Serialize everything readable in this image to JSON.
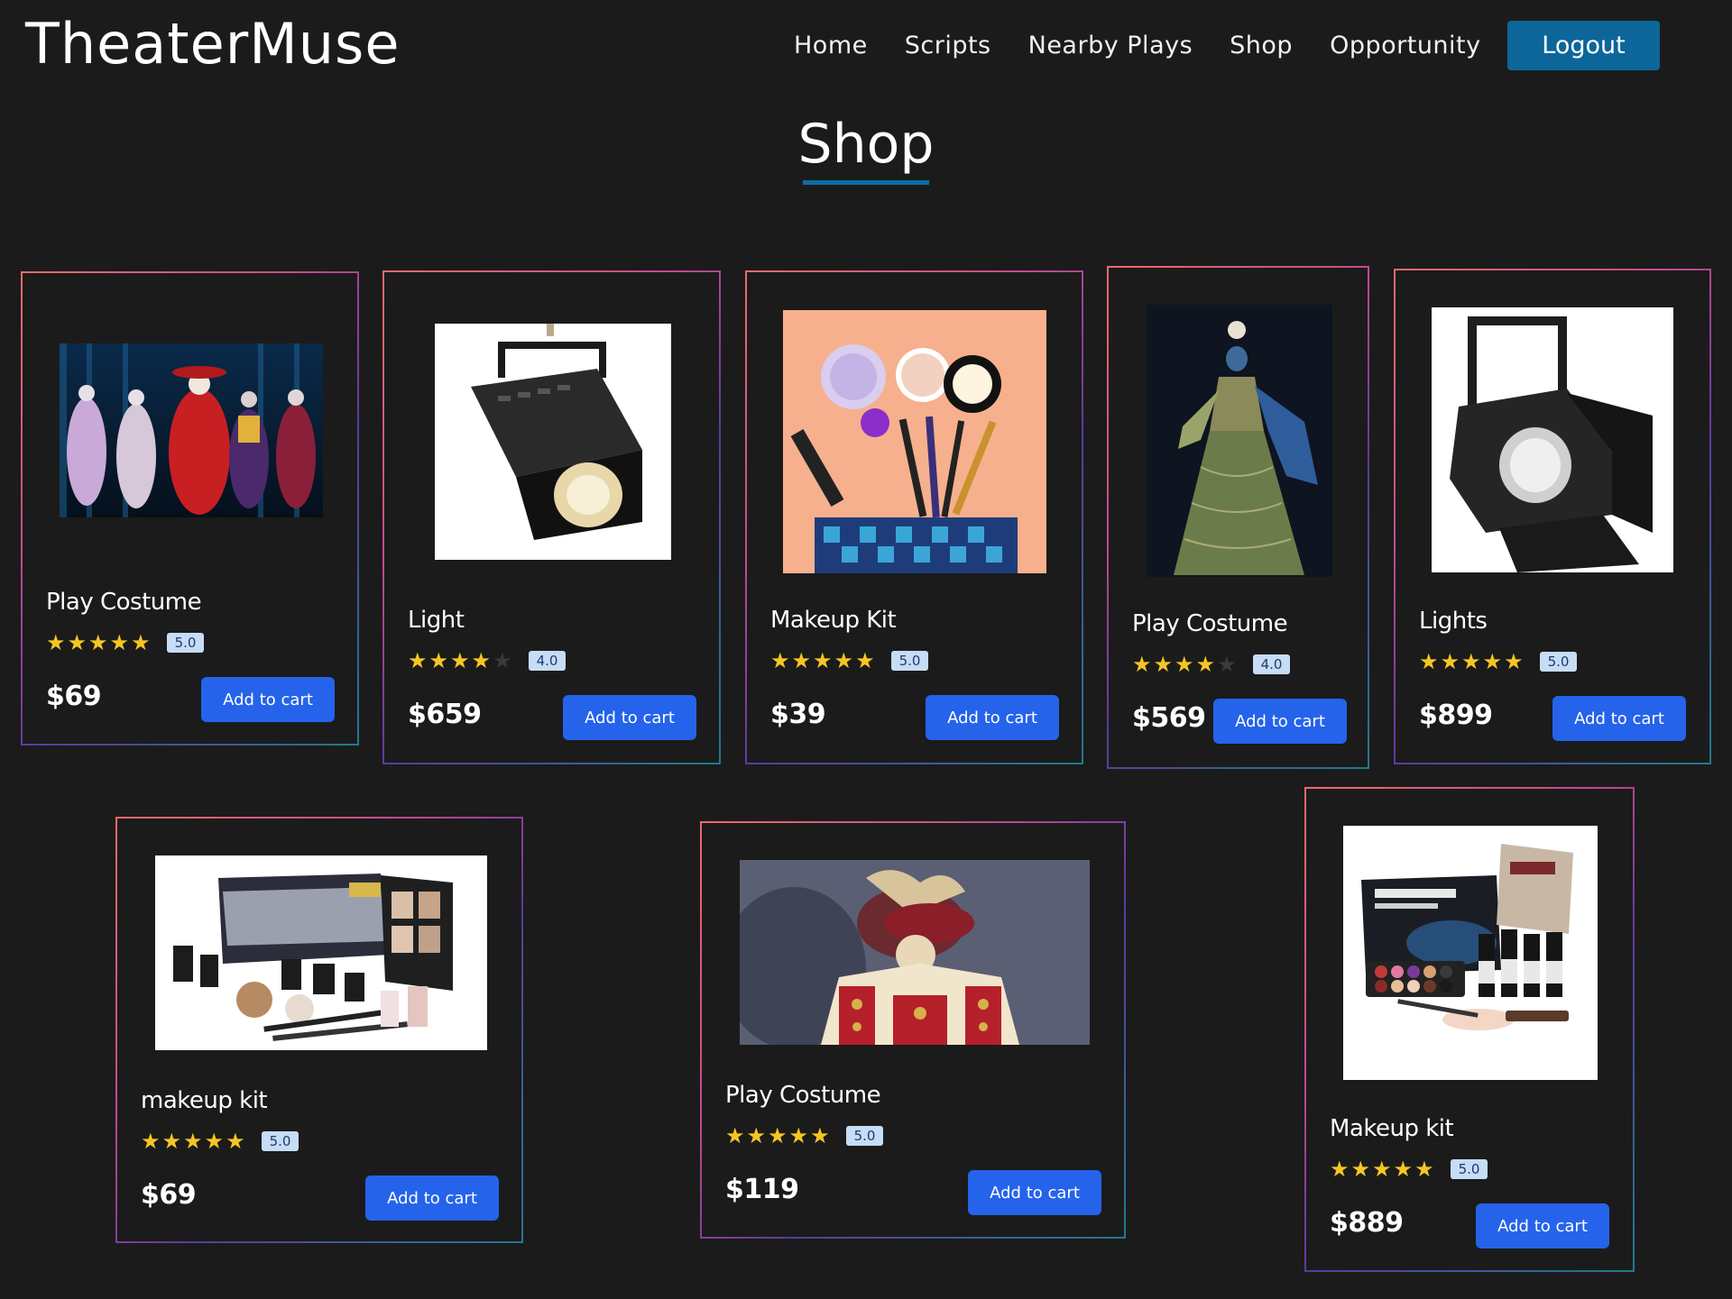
{
  "header": {
    "brand": "TheaterMuse",
    "nav": [
      "Home",
      "Scripts",
      "Nearby Plays",
      "Shop",
      "Opportunity"
    ],
    "logout_label": "Logout"
  },
  "page": {
    "title": "Shop"
  },
  "products": [
    {
      "name": "Play Costume",
      "rating": 5,
      "rating_label": "5.0",
      "price": "$69",
      "button_label": "Add to cart",
      "image": "costume-gallery-photo"
    },
    {
      "name": "Light",
      "rating": 4,
      "rating_label": "4.0",
      "price": "$659",
      "button_label": "Add to cart",
      "image": "stage-spotlight-photo"
    },
    {
      "name": "Makeup Kit",
      "rating": 5,
      "rating_label": "5.0",
      "price": "$39",
      "button_label": "Add to cart",
      "image": "makeup-items-photo"
    },
    {
      "name": "Play Costume",
      "rating": 4,
      "rating_label": "4.0",
      "price": "$569",
      "button_label": "Add to cart",
      "image": "gown-costume-photo"
    },
    {
      "name": "Lights",
      "rating": 5,
      "rating_label": "5.0",
      "price": "$899",
      "button_label": "Add to cart",
      "image": "fresnel-light-photo"
    },
    {
      "name": "makeup kit",
      "rating": 5,
      "rating_label": "5.0",
      "price": "$69",
      "button_label": "Add to cart",
      "image": "celebre-makeup-kit-photo"
    },
    {
      "name": "Play Costume",
      "rating": 5,
      "rating_label": "5.0",
      "price": "$119",
      "button_label": "Add to cart",
      "image": "royal-costume-photo"
    },
    {
      "name": "Makeup kit",
      "rating": 5,
      "rating_label": "5.0",
      "price": "$889",
      "button_label": "Add to cart",
      "image": "creamblend-makeup-kit-photo"
    }
  ],
  "colors": {
    "background": "#1b1b1b",
    "accent": "#0c6699",
    "button": "#2563eb",
    "star": "#f5c623",
    "badge": "#c7dcf5"
  }
}
